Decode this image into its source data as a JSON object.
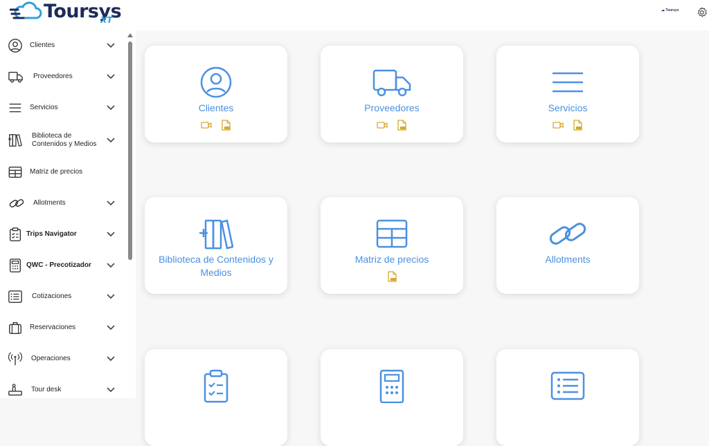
{
  "brand": {
    "name": "Toursys",
    "suffix": "XT",
    "mini": "Toursys"
  },
  "colors": {
    "accent": "#4a90e2",
    "doc_icon": "#d4a72c",
    "brand_dark": "#1e2b5a",
    "brand_light": "#2fa0dc"
  },
  "header": {
    "settings_icon": "gear-icon"
  },
  "sidebar": {
    "items": [
      {
        "label": "Clientes",
        "icon": "user-circle-icon",
        "expandable": true
      },
      {
        "label": "Proveedores",
        "icon": "truck-icon",
        "expandable": true
      },
      {
        "label": "Servicios",
        "icon": "menu-lines-icon",
        "expandable": true
      },
      {
        "label": "Biblioteca de Contenidos y Medios",
        "line1": "Biblioteca de",
        "line2": "Contenidos y Medios",
        "icon": "books-icon",
        "expandable": true
      },
      {
        "label": "Matriz de precios",
        "icon": "table-icon",
        "expandable": false
      },
      {
        "label": "Allotments",
        "icon": "link-icon",
        "expandable": true
      },
      {
        "label": "Trips Navigator",
        "icon": "clipboard-icon",
        "expandable": true
      },
      {
        "label": "QWC - Precotizador",
        "icon": "calculator-icon",
        "expandable": true
      },
      {
        "label": "Cotizaciones",
        "icon": "list-icon",
        "expandable": true
      },
      {
        "label": "Reservaciones",
        "icon": "luggage-icon",
        "expandable": true
      },
      {
        "label": "Operaciones",
        "icon": "antenna-icon",
        "expandable": true
      },
      {
        "label": "Tour desk",
        "icon": "tour-desk-icon",
        "expandable": true
      }
    ]
  },
  "cards": [
    {
      "title": "Clientes",
      "icon": "user-circle-icon",
      "video": true,
      "pdf": true
    },
    {
      "title": "Proveedores",
      "icon": "truck-icon",
      "video": true,
      "pdf": true
    },
    {
      "title": "Servicios",
      "icon": "menu-lines-icon",
      "video": true,
      "pdf": true
    },
    {
      "title": "Biblioteca de Contenidos y Medios",
      "line1": "Biblioteca de Contenidos y",
      "line2": "Medios",
      "icon": "books-icon",
      "video": false,
      "pdf": false
    },
    {
      "title": "Matriz de precios",
      "icon": "table-icon",
      "video": false,
      "pdf": true
    },
    {
      "title": "Allotments",
      "icon": "link-icon",
      "video": false,
      "pdf": false
    },
    {
      "title": "",
      "icon": "clipboard-icon"
    },
    {
      "title": "",
      "icon": "calculator-icon"
    },
    {
      "title": "",
      "icon": "list-icon"
    }
  ]
}
